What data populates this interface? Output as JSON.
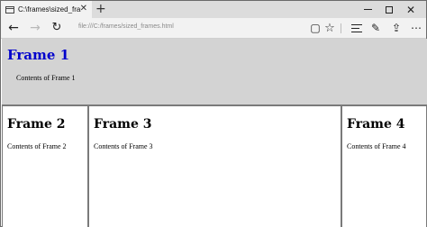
{
  "tab": {
    "title": "C:\\frames\\sized_frames.html",
    "close_glyph": "✕",
    "new_tab_glyph": "+"
  },
  "window": {
    "close_glyph": "✕"
  },
  "nav": {
    "back_glyph": "←",
    "forward_glyph": "→",
    "refresh_glyph": "↻",
    "address": "file:///C:/frames/sized_frames.html"
  },
  "toolbar": {
    "reading_glyph": "▢",
    "favorite_glyph": "☆",
    "note_glyph": "✎",
    "share_glyph": "⇪",
    "more_glyph": "⋯"
  },
  "frames": {
    "frame1": {
      "heading": "Frame 1",
      "body": "Contents of Frame 1",
      "heading_color": "#0000cc",
      "background": "#d3d3d3"
    },
    "frame2": {
      "heading": "Frame 2",
      "body": "Contents of Frame 2"
    },
    "frame3": {
      "heading": "Frame 3",
      "body": "Contents of Frame 3"
    },
    "frame4": {
      "heading": "Frame 4",
      "body": "Contents of Frame 4"
    }
  }
}
